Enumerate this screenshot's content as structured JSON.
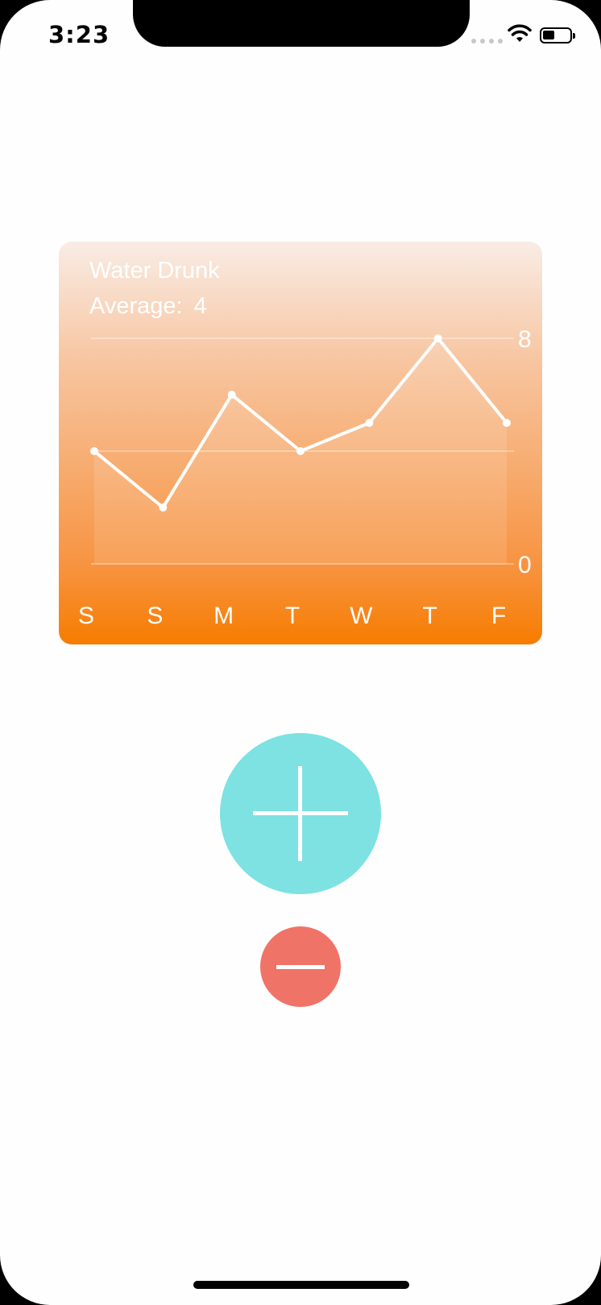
{
  "status_bar": {
    "time": "3:23"
  },
  "chart": {
    "title": "Water Drunk",
    "average_label": "Average:",
    "average_value": "4"
  },
  "chart_data": {
    "type": "line",
    "categories": [
      "S",
      "S",
      "M",
      "T",
      "W",
      "T",
      "F"
    ],
    "values": [
      4,
      2,
      6,
      4,
      5,
      8,
      5
    ],
    "ylim": [
      0,
      8
    ],
    "y_tick_labels": [
      "8",
      "0"
    ],
    "gridlines": [
      0,
      4,
      8
    ],
    "title": "Water Drunk",
    "xlabel": "",
    "ylabel": "",
    "line_color": "#ffffff",
    "gradient_colors": [
      "#f9ece5",
      "#f77c00"
    ]
  },
  "buttons": {
    "add_color": "#7de2e1",
    "remove_color": "#f07368"
  },
  "icons": {
    "add": "plus-icon",
    "remove": "minus-icon",
    "wifi": "wifi-icon",
    "battery": "battery-icon",
    "signal": "signal-icon"
  }
}
